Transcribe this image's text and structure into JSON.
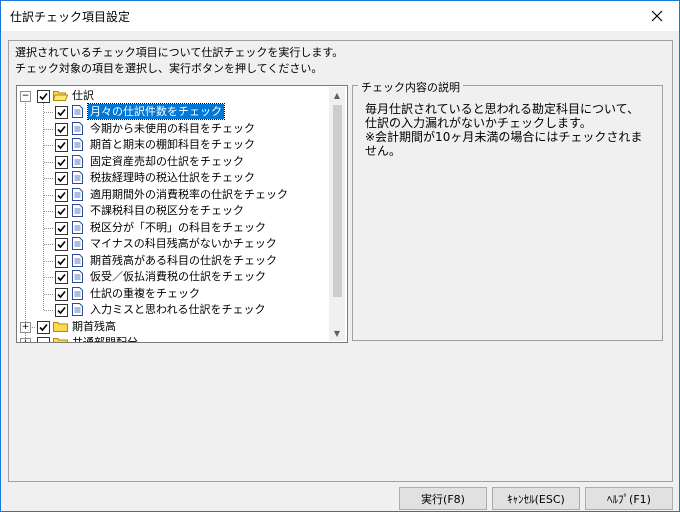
{
  "window": {
    "title": "仕訳チェック項目設定"
  },
  "intro": {
    "line1": "選択されているチェック項目について仕訳チェックを実行します。",
    "line2": "チェック対象の項目を選択し、実行ボタンを押してください。"
  },
  "tree": {
    "root": {
      "label": "仕訳",
      "expanded": true,
      "checked": true
    },
    "items": [
      {
        "label": "月々の仕訳件数をチェック",
        "checked": true,
        "selected": true
      },
      {
        "label": "今期から未使用の科目をチェック",
        "checked": true
      },
      {
        "label": "期首と期末の棚卸科目をチェック",
        "checked": true
      },
      {
        "label": "固定資産売却の仕訳をチェック",
        "checked": true
      },
      {
        "label": "税抜経理時の税込仕訳をチェック",
        "checked": true
      },
      {
        "label": "適用期間外の消費税率の仕訳をチェック",
        "checked": true
      },
      {
        "label": "不課税科目の税区分をチェック",
        "checked": true
      },
      {
        "label": "税区分が「不明」の科目をチェック",
        "checked": true
      },
      {
        "label": "マイナスの科目残高がないかチェック",
        "checked": true
      },
      {
        "label": "期首残高がある科目の仕訳をチェック",
        "checked": true
      },
      {
        "label": "仮受／仮払消費税の仕訳をチェック",
        "checked": true
      },
      {
        "label": "仕訳の重複をチェック",
        "checked": true
      },
      {
        "label": "入力ミスと思われる仕訳をチェック",
        "checked": true
      }
    ],
    "folder2": {
      "label": "期首残高",
      "checked": true
    },
    "folder3": {
      "label": "共通部門配分",
      "checked": false
    }
  },
  "details": {
    "group_title": "チェック内容の説明",
    "text": "毎月仕訳されていると思われる勘定科目について、\n仕訳の入力漏れがないかチェックします。\n※会計期間が10ヶ月未満の場合にはチェックされま\nせん。"
  },
  "buttons": {
    "run": "実行(F8)",
    "cancel": "ｷｬﾝｾﾙ(ESC)",
    "help": "ﾍﾙﾌﾟ(F1)"
  },
  "colors": {
    "selection": "#0078d7",
    "folder": "#ffd94d",
    "window_border": "#1a78d7"
  }
}
